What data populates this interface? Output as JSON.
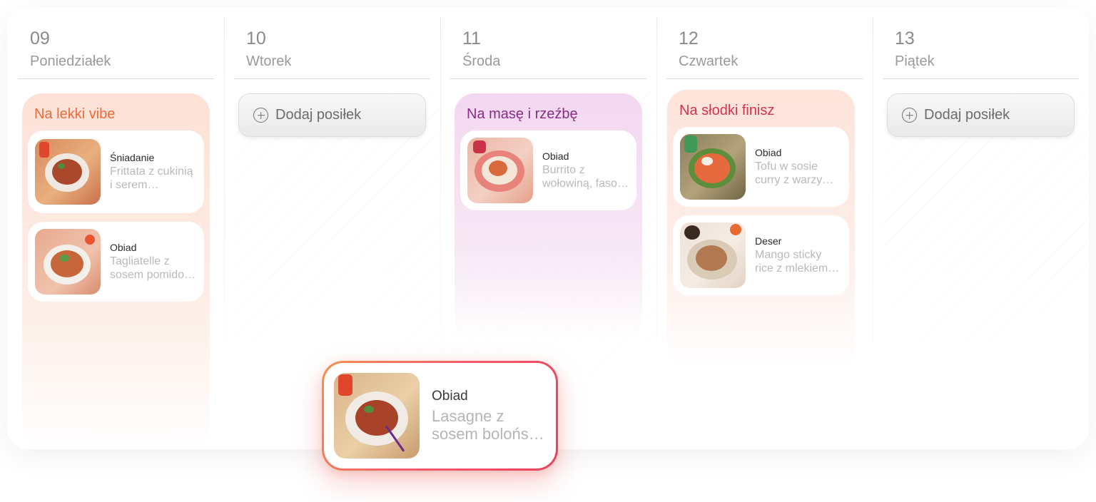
{
  "days": [
    {
      "number": "09",
      "name": "Poniedziałek"
    },
    {
      "number": "10",
      "name": "Wtorek"
    },
    {
      "number": "11",
      "name": "Środa"
    },
    {
      "number": "12",
      "name": "Czwartek"
    },
    {
      "number": "13",
      "name": "Piątek"
    }
  ],
  "plans": {
    "mon": {
      "title": "Na lekki vibe",
      "color": "#ef6a3a",
      "meals": [
        {
          "type": "Śniadanie",
          "name": "Frittata z cukinią i serem…"
        },
        {
          "type": "Obiad",
          "name": "Tagliatelle z sosem pomido…"
        }
      ]
    },
    "wed": {
      "title": "Na masę i rzeźbę",
      "color": "#8a2c86",
      "meals": [
        {
          "type": "Obiad",
          "name": "Burrito z wołowiną, faso…"
        }
      ]
    },
    "thu": {
      "title": "Na słodki finisz",
      "color": "#d6324e",
      "meals": [
        {
          "type": "Obiad",
          "name": "Tofu w sosie curry z warzy…"
        },
        {
          "type": "Deser",
          "name": "Mango sticky rice z mlekiem…"
        }
      ]
    }
  },
  "add_meal_label": "Dodaj posiłek",
  "dragged_meal": {
    "type": "Obiad",
    "name": "Lasagne z sosem bolońs…"
  },
  "icons": {
    "add": "plus-circle-icon"
  }
}
